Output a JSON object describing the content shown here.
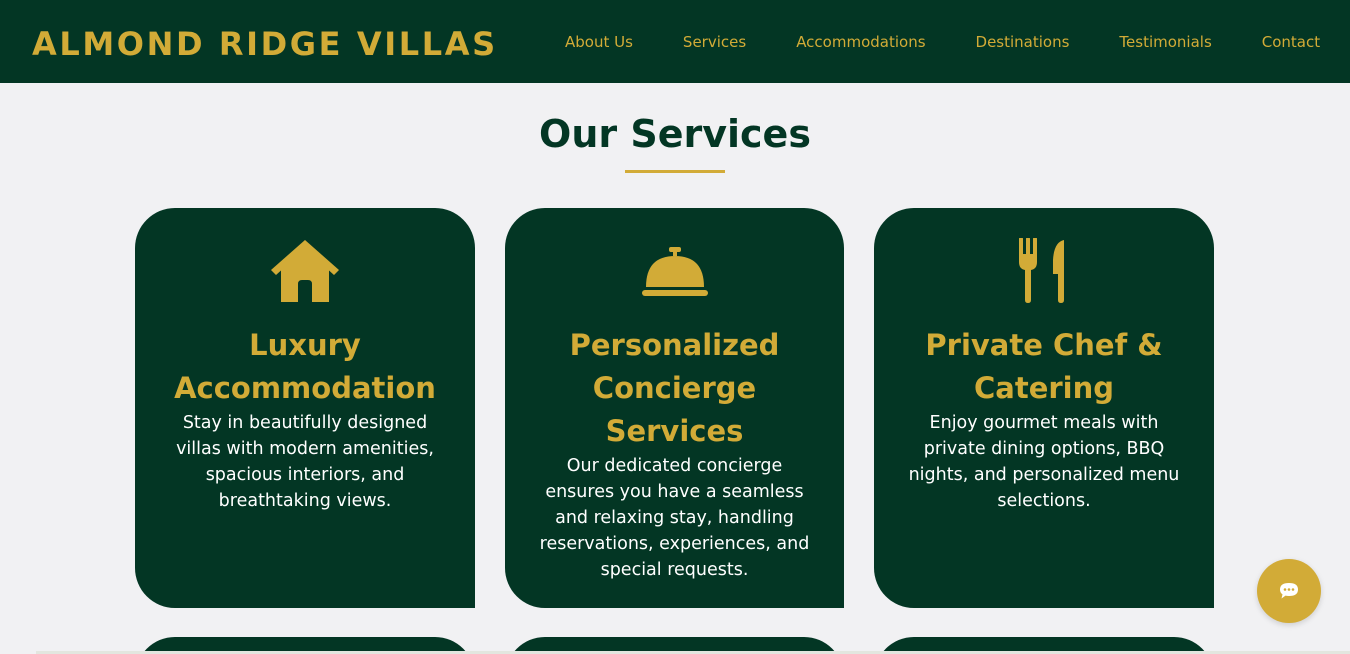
{
  "header": {
    "brand": "ALMOND RIDGE VILLAS",
    "nav": [
      "About Us",
      "Services",
      "Accommodations",
      "Destinations",
      "Testimonials",
      "Contact"
    ]
  },
  "section": {
    "title": "Our Services"
  },
  "services": [
    {
      "icon": "house-icon",
      "title": "Luxury Accommodation",
      "description": "Stay in beautifully designed villas with modern amenities, spacious interiors, and breathtaking views."
    },
    {
      "icon": "concierge-bell-icon",
      "title": "Personalized Concierge Services",
      "description": "Our dedicated concierge ensures you have a seamless and relaxing stay, handling reservations, experiences, and special requests."
    },
    {
      "icon": "utensils-icon",
      "title": "Private Chef & Catering",
      "description": "Enjoy gourmet meals with private dining options, BBQ nights, and personalized menu selections."
    }
  ],
  "chat": {
    "icon": "chat-bubble-icon"
  },
  "colors": {
    "primary": "#033624",
    "accent": "#d2ab37",
    "background": "#f1f1f3"
  }
}
